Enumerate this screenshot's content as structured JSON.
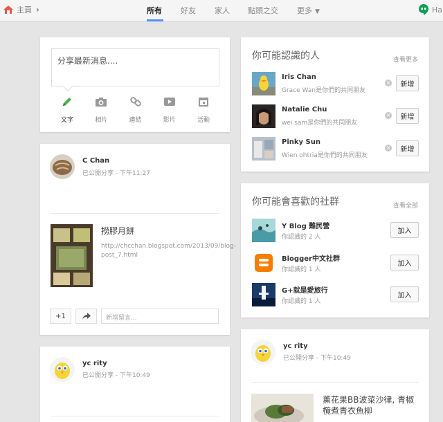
{
  "topbar": {
    "home_label": "主頁",
    "tabs": [
      {
        "label": "所有",
        "active": true
      },
      {
        "label": "好友",
        "active": false
      },
      {
        "label": "家人",
        "active": false
      },
      {
        "label": "點頭之交",
        "active": false
      },
      {
        "label": "更多",
        "active": false
      }
    ],
    "hangouts_label": "Ha",
    "accent": "#4d90fe"
  },
  "share": {
    "placeholder": "分享最新消息....",
    "buttons": [
      {
        "label": "文字",
        "icon": "pencil-icon",
        "active": true
      },
      {
        "label": "相片",
        "icon": "camera-icon",
        "active": false
      },
      {
        "label": "連結",
        "icon": "link-icon",
        "active": false
      },
      {
        "label": "影片",
        "icon": "video-icon",
        "active": false
      },
      {
        "label": "活動",
        "icon": "calendar-icon",
        "active": false
      }
    ]
  },
  "post1": {
    "author": "C Chan",
    "meta": "已公開分享 - 下午11:27",
    "link_title": "撈膠月餅",
    "link_url": "http://chcchan.blogspot.com/2013/09/blog-post_7.html",
    "plus_label": "+1",
    "comment_placeholder": "新增留言..."
  },
  "post2": {
    "author": "yc rity",
    "meta": "已公開分享 - 下午10:49"
  },
  "people": {
    "title": "你可能認識的人",
    "see_more": "查看更多",
    "items": [
      {
        "name": "Iris Chan",
        "sub": "Grace Wan是你們的共同朋友",
        "add": "新增"
      },
      {
        "name": "Natalie Chu",
        "sub": "wei sam是你們的共同朋友",
        "add": "新增"
      },
      {
        "name": "Pinky Sun",
        "sub": "Wien ohtria是你們的共同朋友",
        "add": "新增"
      }
    ]
  },
  "communities": {
    "title": "你可能會喜歡的社群",
    "see_all": "查看全部",
    "items": [
      {
        "name": "Y Blog 難民營",
        "sub": "你認識的 2 人",
        "join": "加入"
      },
      {
        "name": "Blogger中文社群",
        "sub": "你認識的 1 人",
        "join": "加入"
      },
      {
        "name": "G+就是愛旅行",
        "sub": "你認識的 1 人",
        "join": "加入"
      }
    ]
  },
  "post3": {
    "author": "yc rity",
    "meta": "已公開分享 - 下午10:49",
    "title": "薰花果BB波菜沙律, 青椒欖煮青衣魚柳"
  }
}
